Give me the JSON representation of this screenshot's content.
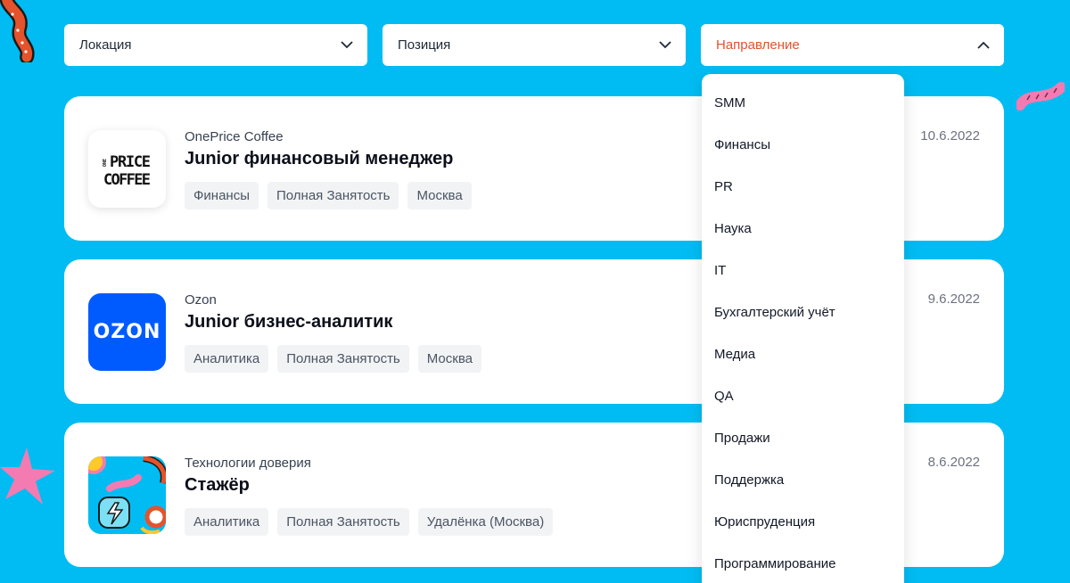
{
  "filters": {
    "location": "Локация",
    "position": "Позиция",
    "direction": "Направление",
    "direction_color": "#E4532B"
  },
  "dropdown": {
    "items": [
      "SMM",
      "Финансы",
      "PR",
      "Наука",
      "IT",
      "Бухгалтерский учёт",
      "Медиа",
      "QA",
      "Продажи",
      "Поддержка",
      "Юриспруденция",
      "Программирование"
    ]
  },
  "jobs": [
    {
      "company": "OnePrice Coffee",
      "title": "Junior финансовый менеджер",
      "tags": [
        "Финансы",
        "Полная Занятость",
        "Москва"
      ],
      "date": "10.6.2022",
      "logo": {
        "icon": "oneprice-coffee-logo",
        "line1_small": "ONE",
        "line1": "PRICE",
        "line2": "COFFEE"
      }
    },
    {
      "company": "Ozon",
      "title": "Junior бизнес-аналитик",
      "tags": [
        "Аналитика",
        "Полная Занятость",
        "Москва"
      ],
      "date": "9.6.2022",
      "logo": {
        "icon": "ozon-logo",
        "text": "OZON",
        "color": "#005BFF"
      }
    },
    {
      "company": "Технологии доверия",
      "title": "Стажёр",
      "tags": [
        "Аналитика",
        "Полная Занятость",
        "Удалёнка (Москва)"
      ],
      "date": "8.6.2022",
      "logo": {
        "icon": "technologii-doveriya-logo"
      }
    }
  ],
  "colors": {
    "background": "#00BCF2",
    "accent": "#E4532B"
  }
}
